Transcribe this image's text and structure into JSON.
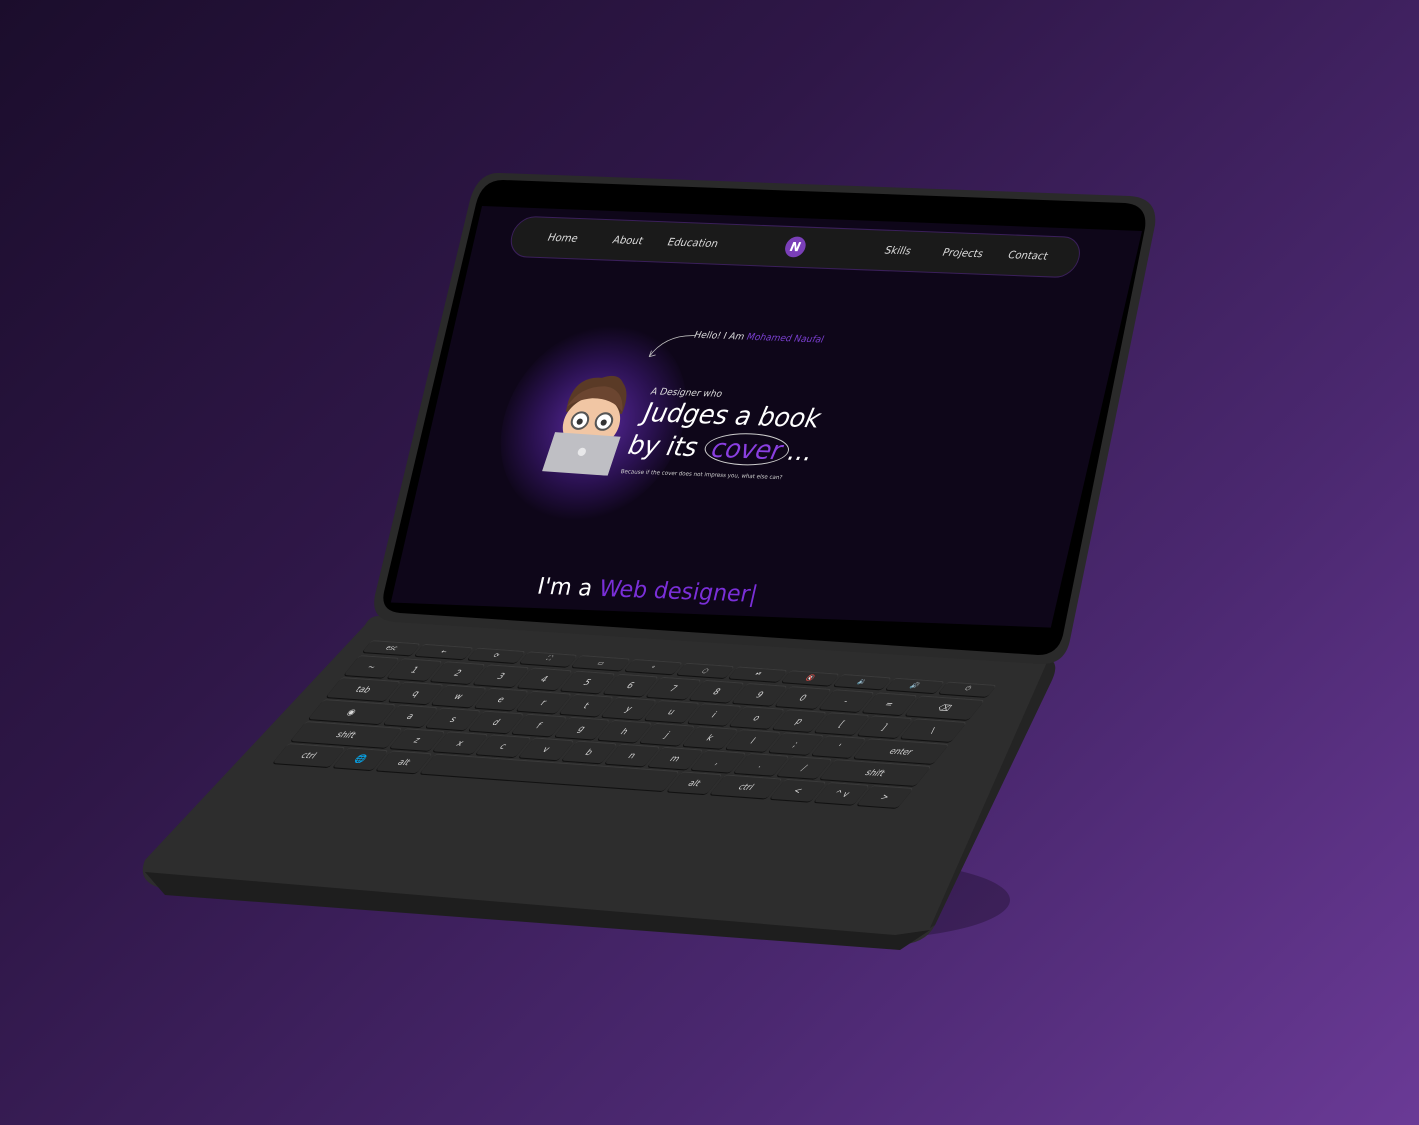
{
  "nav": {
    "items": [
      "Home",
      "About",
      "Education",
      "Skills",
      "Projects",
      "Contact"
    ],
    "logo": "N"
  },
  "hero": {
    "greeting": "Hello! I Am",
    "name": "Mohamed Naufal",
    "intro": "A Designer who",
    "line1": "Judges a book",
    "line2_prefix": "by its",
    "line2_highlight": "cover",
    "line2_suffix": "...",
    "tagline": "Because if the cover does not impress you, what else can?",
    "role_prefix": "I'm a",
    "role_highlight": "Web designer|"
  },
  "colors": {
    "accent": "#7a2fd8",
    "screen_bg": "#0e0619",
    "laptop_body": "#2b2b2b"
  },
  "keyboard": {
    "rows": [
      [
        "esc",
        "←",
        "⟳",
        "⛶",
        "▭",
        "∘",
        "○",
        "⏯",
        "🔇",
        "🔉",
        "🔊",
        "⏻"
      ],
      [
        "~",
        "1",
        "2",
        "3",
        "4",
        "5",
        "6",
        "7",
        "8",
        "9",
        "0",
        "-",
        "=",
        "⌫"
      ],
      [
        "tab",
        "q",
        "w",
        "e",
        "r",
        "t",
        "y",
        "u",
        "i",
        "o",
        "p",
        "[",
        "]",
        "\\"
      ],
      [
        "◉",
        "a",
        "s",
        "d",
        "f",
        "g",
        "h",
        "j",
        "k",
        "l",
        ";",
        "'",
        "enter"
      ],
      [
        "shift",
        "z",
        "x",
        "c",
        "v",
        "b",
        "n",
        "m",
        ",",
        ".",
        "/",
        "shift"
      ],
      [
        "ctrl",
        "🌐",
        "alt",
        "",
        "alt",
        "ctrl",
        "<",
        "^ v",
        ">"
      ]
    ]
  }
}
